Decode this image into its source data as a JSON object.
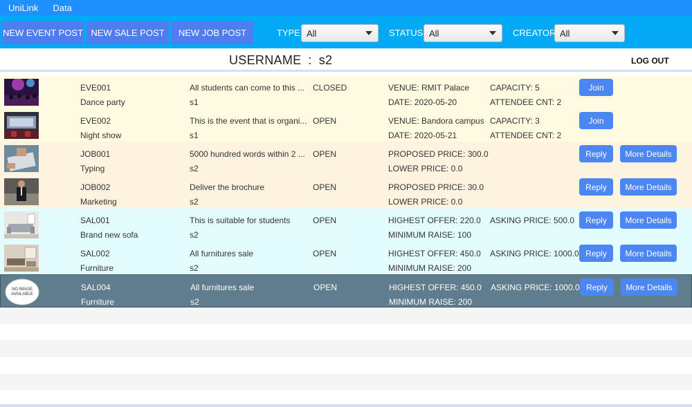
{
  "menu": {
    "items": [
      "UniLink",
      "Data"
    ]
  },
  "toolbar": {
    "buttons": [
      "NEW EVENT POST",
      "NEW SALE POST",
      "NEW JOB POST"
    ],
    "filters": [
      {
        "label": "TYPE :",
        "value": "All"
      },
      {
        "label": "STATUS :",
        "value": "All"
      },
      {
        "label": "CREATOR :",
        "value": "All"
      }
    ]
  },
  "user": {
    "label": "USERNAME",
    "separator": ":",
    "name": "s2",
    "logout": "LOG OUT"
  },
  "rows": [
    {
      "kind": "event",
      "thumb": "party-photo",
      "id": "EVE001",
      "title": "Dance party",
      "desc": "All students can come to this ...",
      "creator": "s1",
      "status": "CLOSED",
      "d1": "VENUE: RMIT Palace",
      "d2": "DATE: 2020-05-20",
      "d3": "CAPACITY: 5",
      "d4": "ATTENDEE CNT: 2",
      "actions": [
        "Join"
      ]
    },
    {
      "kind": "event",
      "thumb": "show-photo",
      "id": "EVE002",
      "title": "Night show",
      "desc": "This is the event that is organi...",
      "creator": "s1",
      "status": "OPEN",
      "d1": "VENUE: Bandora campus",
      "d2": "DATE: 2020-05-21",
      "d3": "CAPACITY: 3",
      "d4": "ATTENDEE CNT: 2",
      "actions": [
        "Join"
      ]
    },
    {
      "kind": "job",
      "thumb": "typing-photo",
      "id": "JOB001",
      "title": "Typing",
      "desc": "5000 hundred words within 2 ...",
      "creator": "s2",
      "status": "OPEN",
      "d1": "PROPOSED PRICE:  300.0",
      "d2": "LOWER PRICE:  0.0",
      "d3": "",
      "d4": "",
      "actions": [
        "Reply",
        "More Details"
      ]
    },
    {
      "kind": "job",
      "thumb": "marketing-photo",
      "id": "JOB002",
      "title": "Marketing",
      "desc": "Deliver the brochure",
      "creator": "s2",
      "status": "OPEN",
      "d1": "PROPOSED PRICE:  30.0",
      "d2": "LOWER PRICE:  0.0",
      "d3": "",
      "d4": "",
      "actions": [
        "Reply",
        "More Details"
      ]
    },
    {
      "kind": "sale",
      "thumb": "sofa-photo",
      "id": "SAL001",
      "title": "Brand new sofa",
      "desc": "This is suitable for students",
      "creator": "s2",
      "status": "OPEN",
      "d1": "HIGHEST OFFER:  220.0",
      "d2": "MINIMUM RAISE:  100",
      "d3": "ASKING PRICE:  500.0",
      "d4": "",
      "actions": [
        "Reply",
        "More Details"
      ]
    },
    {
      "kind": "sale",
      "thumb": "furniture-photo",
      "id": "SAL002",
      "title": "Furniture",
      "desc": "All furnitures sale",
      "creator": "s2",
      "status": "OPEN",
      "d1": "HIGHEST OFFER:  450.0",
      "d2": "MINIMUM RAISE:  200",
      "d3": "ASKING PRICE:  1000.0",
      "d4": "",
      "actions": [
        "Reply",
        "More Details"
      ]
    },
    {
      "kind": "sale selected",
      "thumb": "no-image",
      "no_image_text": "NO IMAGE AVAILABLE",
      "id": "SAL004",
      "title": "Furniture",
      "desc": "All furnitures sale",
      "creator": "s2",
      "status": "OPEN",
      "d1": "HIGHEST OFFER:  450.0",
      "d2": "MINIMUM RAISE:  200",
      "d3": "ASKING PRICE:  1000.0",
      "d4": "",
      "actions": [
        "Reply",
        "More Details"
      ]
    }
  ]
}
